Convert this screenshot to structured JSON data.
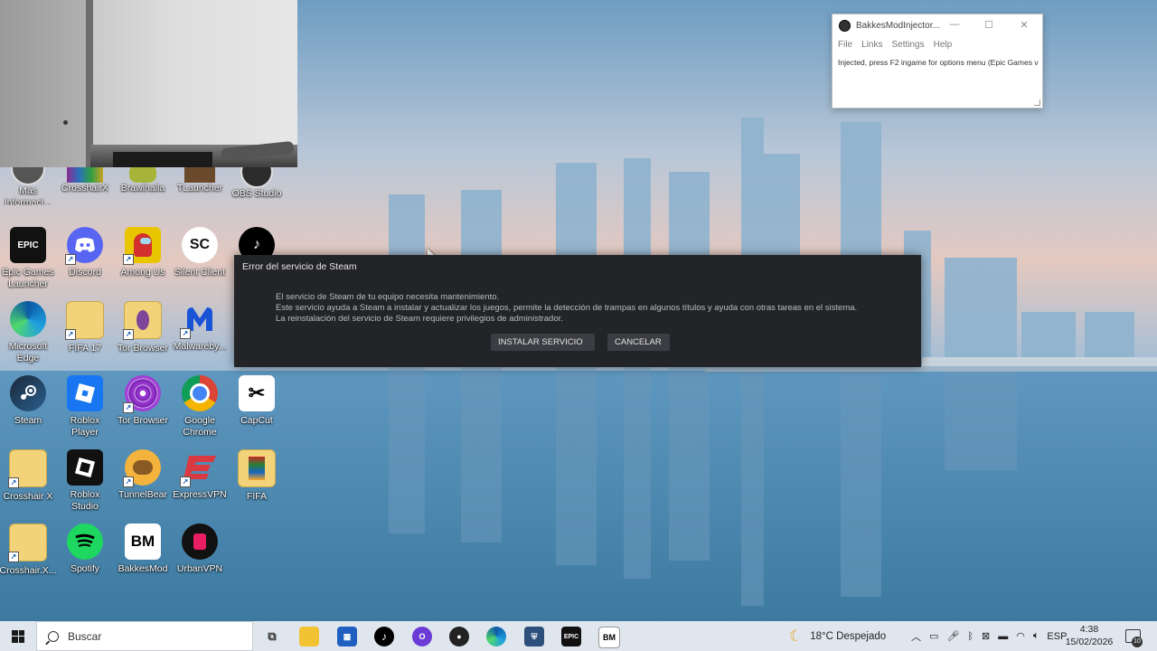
{
  "desktop": {
    "row0": [
      {
        "label": "Más informaci...",
        "icon": "info-icon"
      },
      {
        "label": "CrosshairX",
        "icon": "winrar-icon"
      },
      {
        "label": "Brawlhalla",
        "icon": "brawlhalla-icon"
      },
      {
        "label": "TLauncher",
        "icon": "tlauncher-icon"
      },
      {
        "label": "OBS Studio",
        "icon": "obs-icon"
      }
    ],
    "row1": [
      {
        "label": "Epic Games Launcher",
        "icon": "epic-games-icon",
        "glyph": "EPIC"
      },
      {
        "label": "Discord",
        "icon": "discord-icon"
      },
      {
        "label": "Among Us",
        "icon": "among-us-icon"
      },
      {
        "label": "Silent Client",
        "icon": "silent-client-icon",
        "glyph": "SC"
      },
      {
        "label": "",
        "icon": "tiktok-icon"
      }
    ],
    "row2": [
      {
        "label": "Microsoft Edge",
        "icon": "edge-icon"
      },
      {
        "label": "FIFA 17",
        "icon": "folder-icon"
      },
      {
        "label": "Tor Browser",
        "icon": "folder-icon"
      },
      {
        "label": "Malwareby...",
        "icon": "malwarebytes-icon"
      }
    ],
    "row3": [
      {
        "label": "Steam",
        "icon": "steam-icon"
      },
      {
        "label": "Roblox Player",
        "icon": "roblox-icon"
      },
      {
        "label": "Tor Browser",
        "icon": "tor-icon"
      },
      {
        "label": "Google Chrome",
        "icon": "chrome-icon"
      },
      {
        "label": "CapCut",
        "icon": "capcut-icon"
      }
    ],
    "row4": [
      {
        "label": "Crosshair X",
        "icon": "folder-icon"
      },
      {
        "label": "Roblox Studio",
        "icon": "roblox-studio-icon"
      },
      {
        "label": "TunnelBear",
        "icon": "tunnelbear-icon"
      },
      {
        "label": "ExpressVPN",
        "icon": "expressvpn-icon"
      },
      {
        "label": "FIFA",
        "icon": "fifa-icon"
      }
    ],
    "row5": [
      {
        "label": "Crosshair.X...",
        "icon": "folder-icon"
      },
      {
        "label": "Spotify",
        "icon": "spotify-icon"
      },
      {
        "label": "BakkesMod",
        "icon": "bakkesmod-icon",
        "glyph": "BM"
      },
      {
        "label": "UrbanVPN",
        "icon": "urbanvpn-icon"
      }
    ]
  },
  "bakkes_window": {
    "title": "BakkesModInjector...",
    "menu": [
      "File",
      "Links",
      "Settings",
      "Help"
    ],
    "log": "Injected, press F2 ingame for options menu (Epic Games v"
  },
  "steam_dialog": {
    "title": "Error del servicio de Steam",
    "lines": [
      "El servicio de Steam de tu equipo necesita mantenimiento.",
      "Este servicio ayuda a Steam a instalar y actualizar los juegos, permite la detección de trampas en algunos títulos y ayuda con otras tareas en el sistema.",
      "La reinstalación del servicio de Steam requiere privilegios de administrador."
    ],
    "install_button": "INSTALAR SERVICIO",
    "cancel_button": "CANCELAR"
  },
  "taskbar": {
    "search_placeholder": "Buscar",
    "weather": "18°C  Despejado",
    "language": "ESP",
    "time": "4:38",
    "date": "15/02/2026",
    "notifications": "10"
  }
}
